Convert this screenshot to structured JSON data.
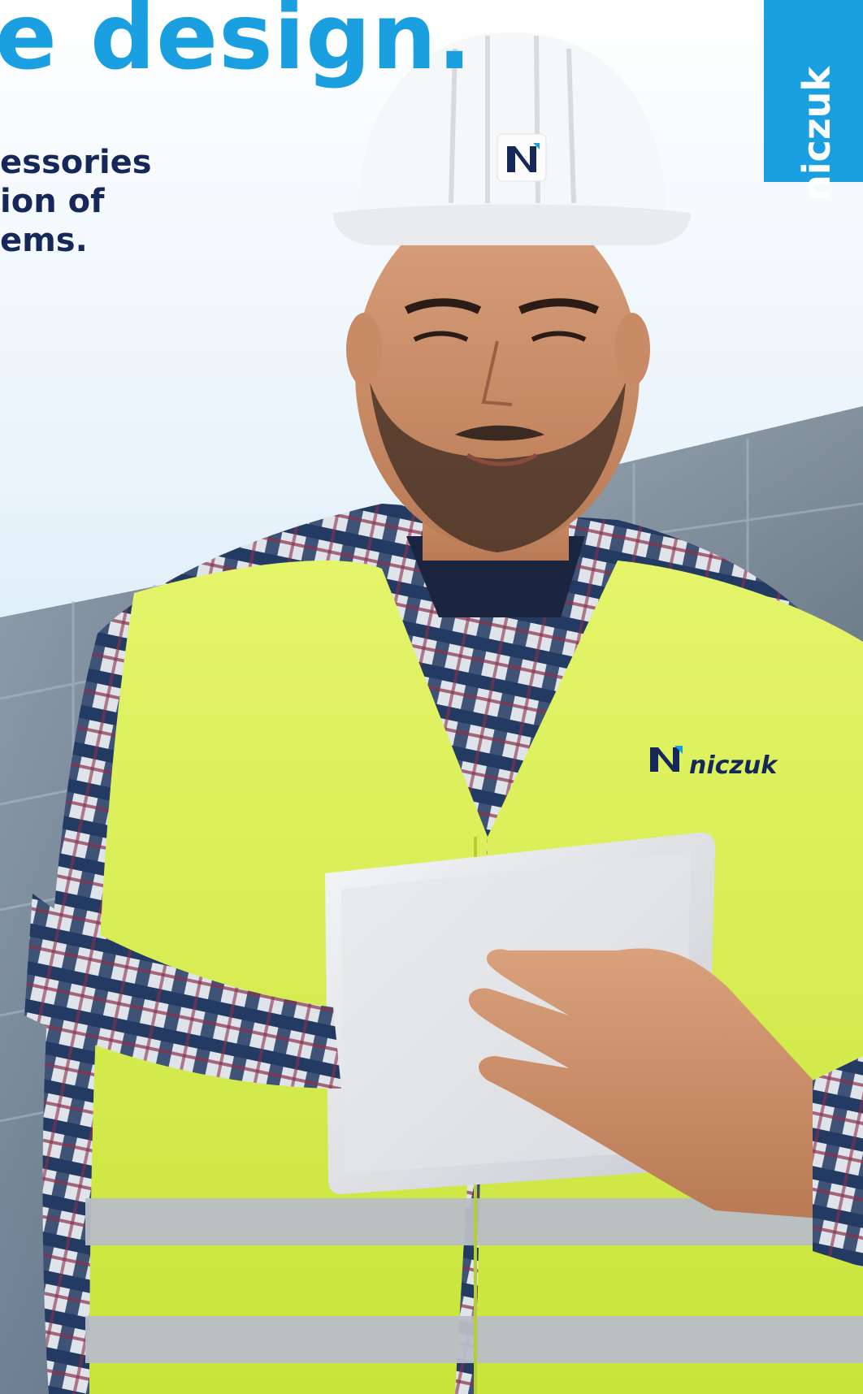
{
  "headline": "e design.",
  "subtitle_lines": [
    "essories",
    "ion of",
    "ems."
  ],
  "brand": {
    "tab_label": "niczuk",
    "vest_label": "niczuk"
  },
  "colors": {
    "brand_blue": "#1aa0e1",
    "navy": "#16285a",
    "hi_vis_yellow": "#d6f04a",
    "sky": "#d9ecf8"
  }
}
